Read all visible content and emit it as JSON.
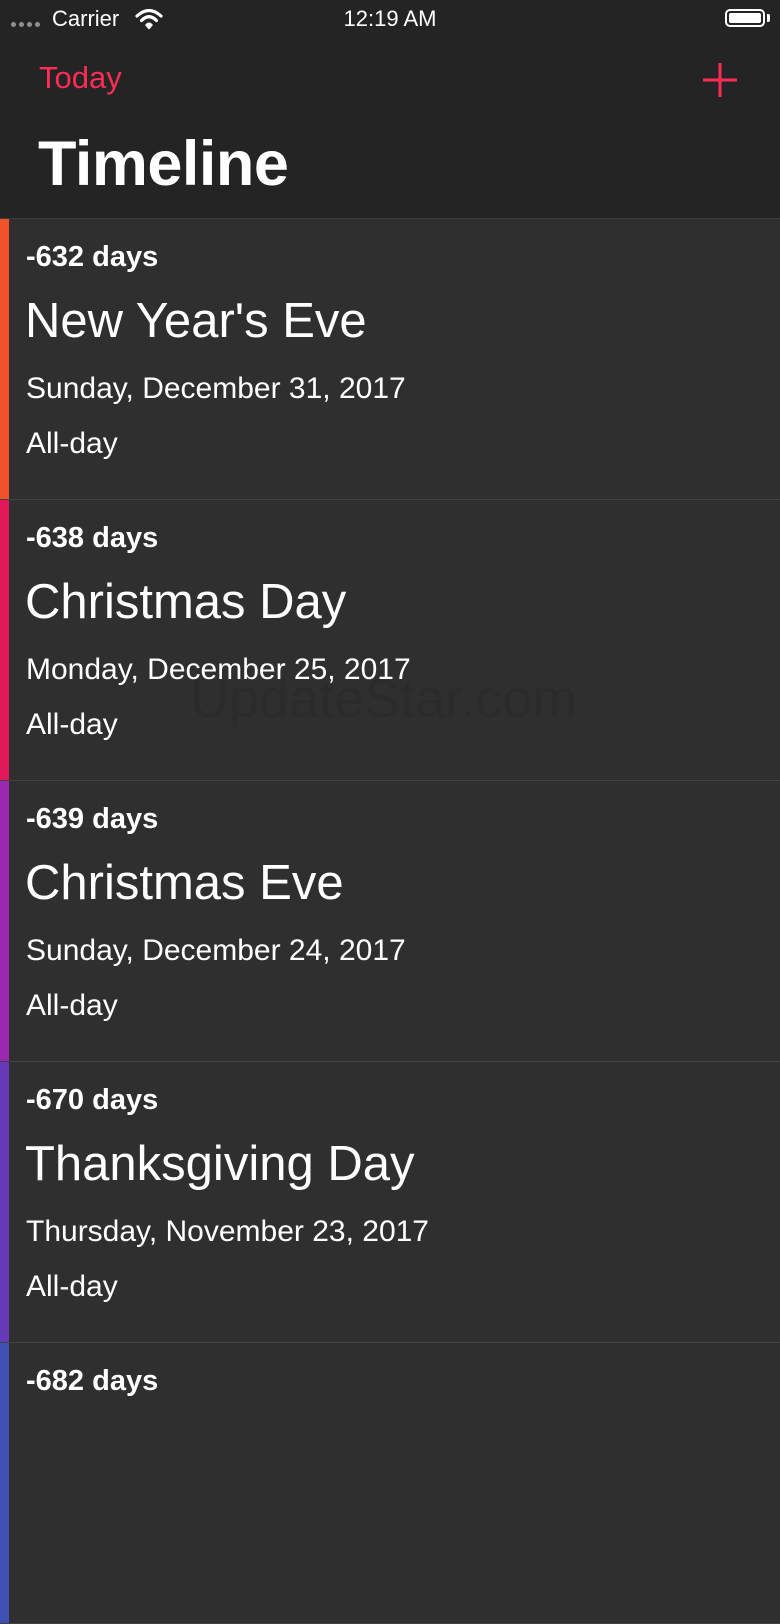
{
  "status_bar": {
    "carrier": "Carrier",
    "time": "12:19 AM"
  },
  "nav": {
    "today_label": "Today",
    "add_icon": "plus-icon",
    "title": "Timeline"
  },
  "events": [
    {
      "days": "-632 days",
      "title": "New Year's Eve",
      "date": "Sunday, December 31, 2017",
      "time": "All-day",
      "color": "#f0532c"
    },
    {
      "days": "-638 days",
      "title": "Christmas Day",
      "date": "Monday, December 25, 2017",
      "time": "All-day",
      "color": "#e0195a"
    },
    {
      "days": "-639 days",
      "title": "Christmas Eve",
      "date": "Sunday, December 24, 2017",
      "time": "All-day",
      "color": "#9c27b0"
    },
    {
      "days": "-670 days",
      "title": "Thanksgiving Day",
      "date": "Thursday, November 23, 2017",
      "time": "All-day",
      "color": "#673ab7"
    },
    {
      "days": "-682 days",
      "title": "",
      "date": "",
      "time": "",
      "color": "#3f51b5"
    }
  ],
  "watermark": "UpdateStar.com",
  "colors": {
    "accent": "#ff2d55",
    "header_bg": "#242424",
    "row_bg": "#2f2f2f"
  }
}
